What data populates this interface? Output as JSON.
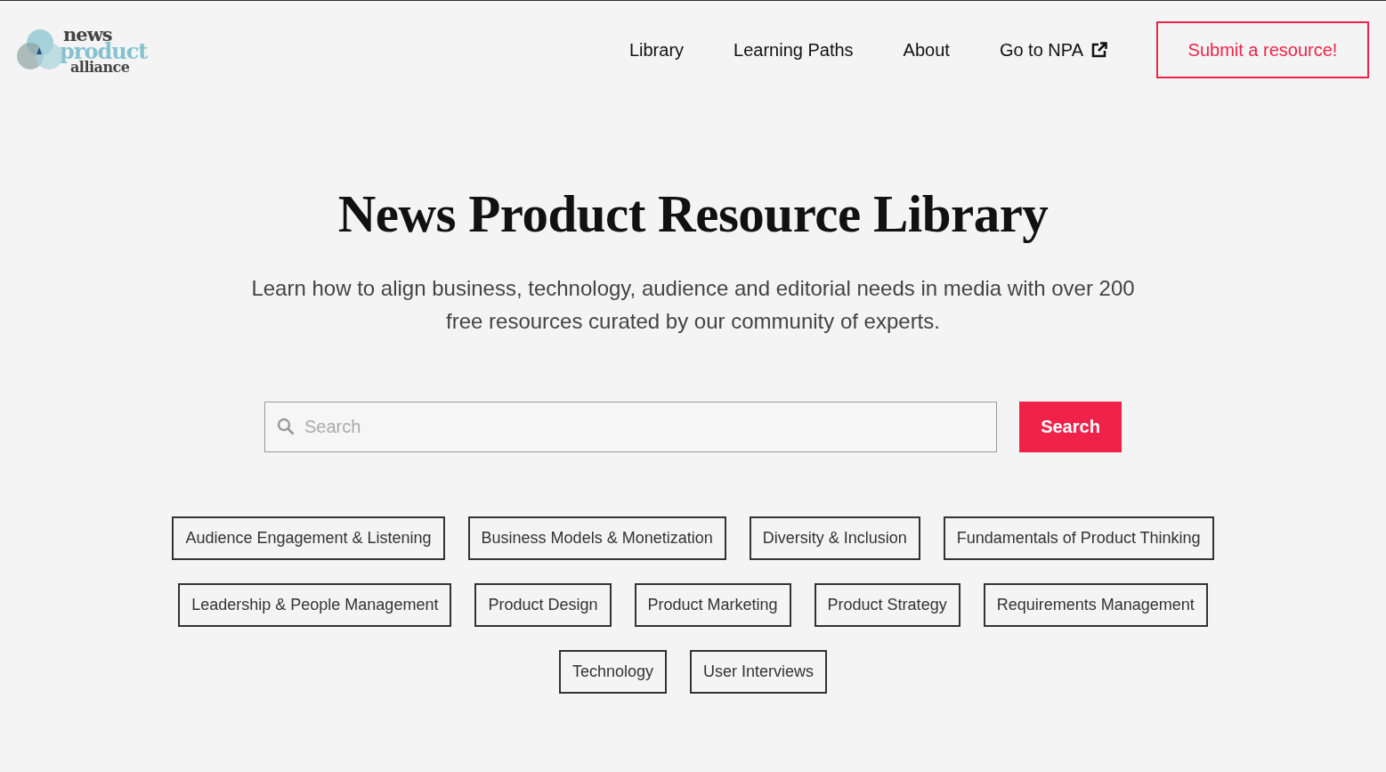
{
  "logo": {
    "lines": [
      "news",
      "product",
      "alliance"
    ]
  },
  "nav": {
    "items": [
      {
        "label": "Library",
        "external": false
      },
      {
        "label": "Learning Paths",
        "external": false
      },
      {
        "label": "About",
        "external": false
      },
      {
        "label": "Go to NPA",
        "external": true
      }
    ],
    "cta": "Submit a resource!"
  },
  "hero": {
    "title": "News Product Resource Library",
    "subtitle": "Learn how to align business, technology, audience and editorial needs in media with over 200 free resources curated by our community of experts."
  },
  "search": {
    "placeholder": "Search",
    "button": "Search"
  },
  "topics": [
    [
      "Audience Engagement & Listening",
      "Business Models & Monetization",
      "Diversity & Inclusion",
      "Fundamentals of Product Thinking"
    ],
    [
      "Leadership & People Management",
      "Product Design",
      "Product Marketing",
      "Product Strategy",
      "Requirements Management"
    ],
    [
      "Technology",
      "User Interviews"
    ]
  ]
}
